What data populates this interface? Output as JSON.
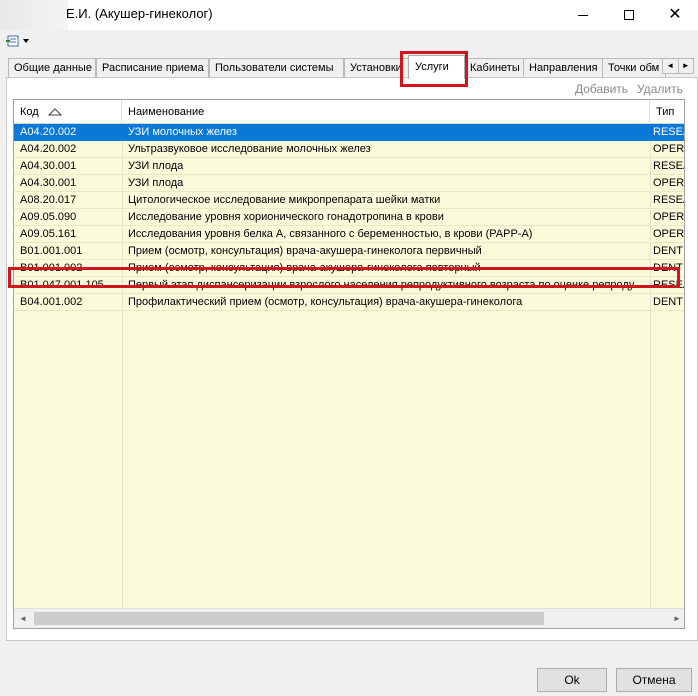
{
  "window": {
    "title": "Е.И. (Акушер-гинеколог)",
    "controls": {
      "minimize": "minimize-icon",
      "maximize": "maximize-icon",
      "close": "✕"
    }
  },
  "tabs": [
    {
      "label": "Общие данные",
      "active": false
    },
    {
      "label": "Расписание приема",
      "active": false
    },
    {
      "label": "Пользователи системы",
      "active": false
    },
    {
      "label": "Установки",
      "active": false
    },
    {
      "label": "Услуги",
      "active": true
    },
    {
      "label": "Кабинеты",
      "active": false
    },
    {
      "label": "Направления",
      "active": false
    },
    {
      "label": "Точки обм",
      "active": false
    }
  ],
  "tab_scroll": {
    "left": "◄",
    "right": "►"
  },
  "actions": {
    "add": "Добавить",
    "delete": "Удалить"
  },
  "grid": {
    "columns": [
      {
        "label": "Код",
        "sort_icon": "sort-up-icon"
      },
      {
        "label": "Наименование"
      },
      {
        "label": "Тип"
      }
    ],
    "rows": [
      {
        "code": "A04.20.002",
        "name": "УЗИ молочных желез",
        "type": "RESEA",
        "selected": true
      },
      {
        "code": "A04.20.002",
        "name": "Ультразвуковое исследование молочных желез",
        "type": "OPERA"
      },
      {
        "code": "A04.30.001",
        "name": "УЗИ плода",
        "type": "RESEA"
      },
      {
        "code": "A04.30.001",
        "name": "УЗИ плода",
        "type": "OPERA"
      },
      {
        "code": "A08.20.017",
        "name": "Цитологическое исследование микропрепарата шейки матки",
        "type": "RESEA"
      },
      {
        "code": "A09.05.090",
        "name": "Исследование уровня хорионического гонадотропина в крови",
        "type": "OPERA"
      },
      {
        "code": "A09.05.161",
        "name": "Исследования уровня белка А, связанного с беременностью, в крови (PAPP-A)",
        "type": "OPERA"
      },
      {
        "code": "B01.001.001",
        "name": "Прием (осмотр, консультация) врача-акушера-гинеколога первичный",
        "type": "DENT"
      },
      {
        "code": "B01.001.002",
        "name": "Прием (осмотр, консультация) врача-акушера-гинеколога повторный",
        "type": "DENT"
      },
      {
        "code": "B01.047.001.105",
        "name": "Первый этап диспансеризации взрослого населения репродуктивного возраста по оценке репродуктивного здоровья",
        "type": "RESEA"
      },
      {
        "code": "B04.001.002",
        "name": "Профилактический прием (осмотр, консультация) врача-акушера-гинеколога",
        "type": "DENT"
      }
    ]
  },
  "scrollbar": {
    "left": "◄",
    "right": "►"
  },
  "buttons": {
    "ok": "Ok",
    "cancel": "Отмена"
  },
  "colors": {
    "selection": "#0a78d7",
    "row_bg": "#fbfbdc",
    "highlight": "#d2141d"
  }
}
